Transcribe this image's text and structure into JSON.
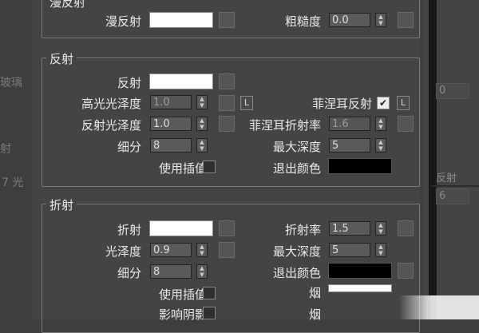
{
  "background": {
    "left_texts": [
      "玻璃",
      "射",
      "7 光"
    ],
    "right_values": [
      "0",
      "反射",
      "6"
    ]
  },
  "top_group": {
    "title": "漫反射",
    "diffuse_label": "漫反射",
    "roughness_label": "粗糙度",
    "roughness_value": "0.0"
  },
  "reflect_group": {
    "title": "反射",
    "reflect_label": "反射",
    "hilight_gloss_label": "高光光泽度",
    "hilight_gloss_value": "1.0",
    "refl_gloss_label": "反射光泽度",
    "refl_gloss_value": "1.0",
    "subdivs_label": "细分",
    "subdivs_value": "8",
    "interp_label": "使用插值",
    "fresnel_label": "菲涅耳反射",
    "fresnel_checked": true,
    "fresnel_ior_label": "菲涅耳折射率",
    "fresnel_ior_value": "1.6",
    "max_depth_label": "最大深度",
    "max_depth_value": "5",
    "exit_color_label": "退出颜色",
    "lock_label": "L"
  },
  "refract_group": {
    "title": "折射",
    "refract_label": "折射",
    "gloss_label": "光泽度",
    "gloss_value": "0.9",
    "subdivs_label": "细分",
    "subdivs_value": "8",
    "interp_label": "使用插值",
    "affect_shadows_label": "影响阴影",
    "ior_label": "折射率",
    "ior_value": "1.5",
    "max_depth_label": "最大深度",
    "max_depth_value": "5",
    "exit_color_label": "退出颜色",
    "fog_label_1": "烟",
    "fog_label_2": "烟"
  },
  "colors": {
    "panel_bg": "#444444",
    "swatch_white": "#ffffff",
    "swatch_black": "#000000"
  }
}
